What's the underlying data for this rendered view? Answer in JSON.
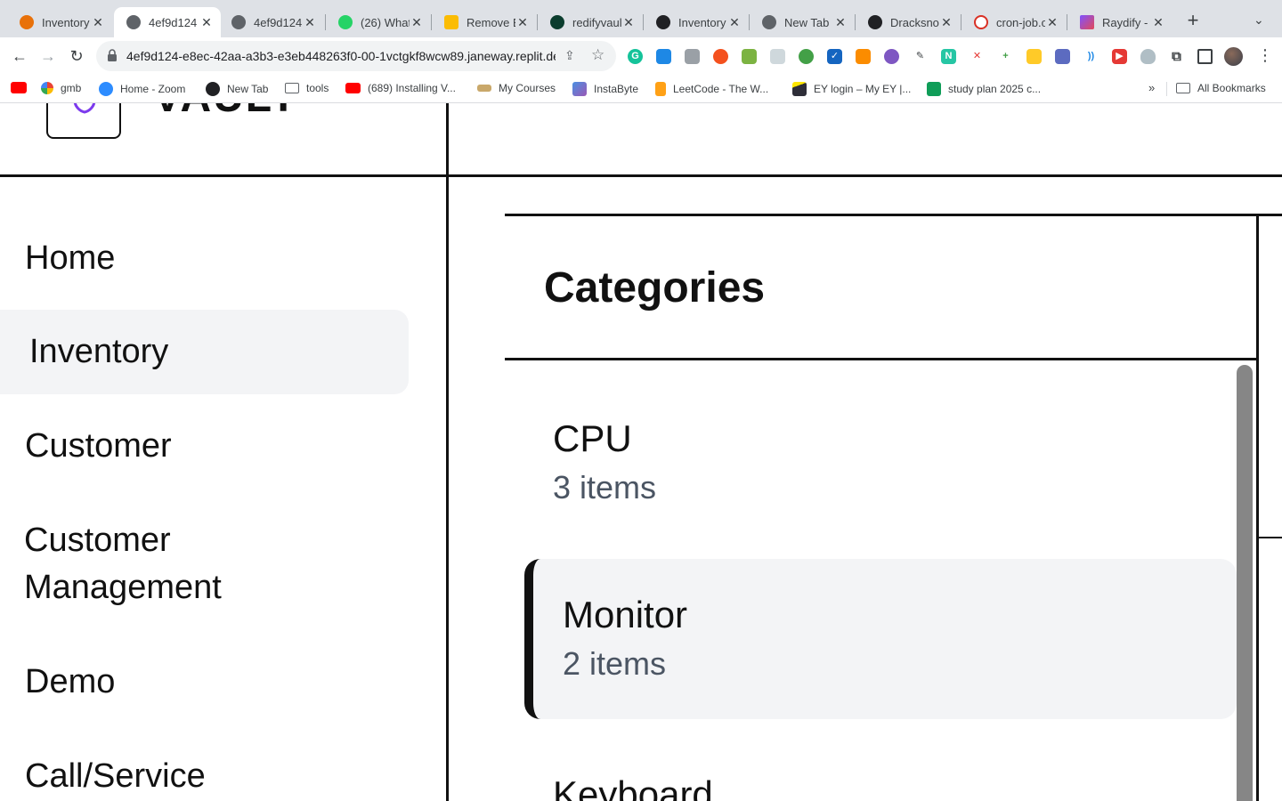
{
  "browser": {
    "tabs": [
      {
        "title": "Inventory",
        "icon": "app-grid-icon",
        "color": "#e8710a"
      },
      {
        "title": "4ef9d124",
        "icon": "globe-icon",
        "color": "#5f6368"
      },
      {
        "title": "4ef9d124",
        "icon": "globe-icon",
        "color": "#5f6368"
      },
      {
        "title": "(26) What",
        "icon": "whatsapp-icon",
        "color": "#25d366"
      },
      {
        "title": "Remove E",
        "icon": "chat-icon",
        "color": "#fbbc04"
      },
      {
        "title": "redifyvaul",
        "icon": "leaf-icon",
        "color": "#0b3d2e"
      },
      {
        "title": "Inventory",
        "icon": "openai-icon",
        "color": "#202124"
      },
      {
        "title": "New Tab",
        "icon": "chrome-icon",
        "color": "#5f6368"
      },
      {
        "title": "Dracksno",
        "icon": "github-icon",
        "color": "#202124"
      },
      {
        "title": "cron-job.o",
        "icon": "clock-icon",
        "color": "#d93025"
      },
      {
        "title": "Raydify -",
        "icon": "kotlin-icon",
        "color": "#7f52ff"
      }
    ],
    "active_tab_index": 1,
    "url": "4ef9d124-e8ec-42aa-a3b3-e3eb448263f0-00-1vctgkf8wcw89.janeway.replit.dev",
    "bookmarks": [
      {
        "label": "gmb",
        "icon": "google-icon",
        "color": "#4285f4"
      },
      {
        "label": "Home - Zoom",
        "icon": "zoom-icon",
        "color": "#2d8cff"
      },
      {
        "label": "New Tab",
        "icon": "openai-icon",
        "color": "#202124"
      },
      {
        "label": "tools",
        "icon": "folder-icon",
        "color": "#5f6368"
      },
      {
        "label": "(689) Installing V...",
        "icon": "youtube-icon",
        "color": "#ff0000"
      },
      {
        "label": "My Courses",
        "icon": "course-icon",
        "color": "#8a6d3b"
      },
      {
        "label": "InstaByte",
        "icon": "rocket-icon",
        "color": "#4a90e2"
      },
      {
        "label": "LeetCode - The W...",
        "icon": "leetcode-icon",
        "color": "#ffa116"
      },
      {
        "label": "EY login – My EY |...",
        "icon": "ey-icon",
        "color": "#2e2e38"
      },
      {
        "label": "study plan 2025 c...",
        "icon": "sheets-icon",
        "color": "#0f9d58"
      }
    ],
    "all_bookmarks": "All Bookmarks"
  },
  "app": {
    "logo_text": "VAULT",
    "nav": [
      {
        "label": "Home"
      },
      {
        "label": "Inventory",
        "active": true
      },
      {
        "label": "Customer"
      },
      {
        "label": "Customer Management"
      },
      {
        "label": "Demo"
      },
      {
        "label": "Call/Service"
      }
    ],
    "panel": {
      "title": "Categories",
      "categories": [
        {
          "name": "CPU",
          "count": "3 items"
        },
        {
          "name": "Monitor",
          "count": "2 items",
          "active": true
        },
        {
          "name": "Keyboard"
        }
      ]
    }
  },
  "colors": {
    "accent": "#111111",
    "active_bg": "#f3f4f6",
    "muted_text": "#4b5563",
    "scrollbar": "#868686"
  }
}
